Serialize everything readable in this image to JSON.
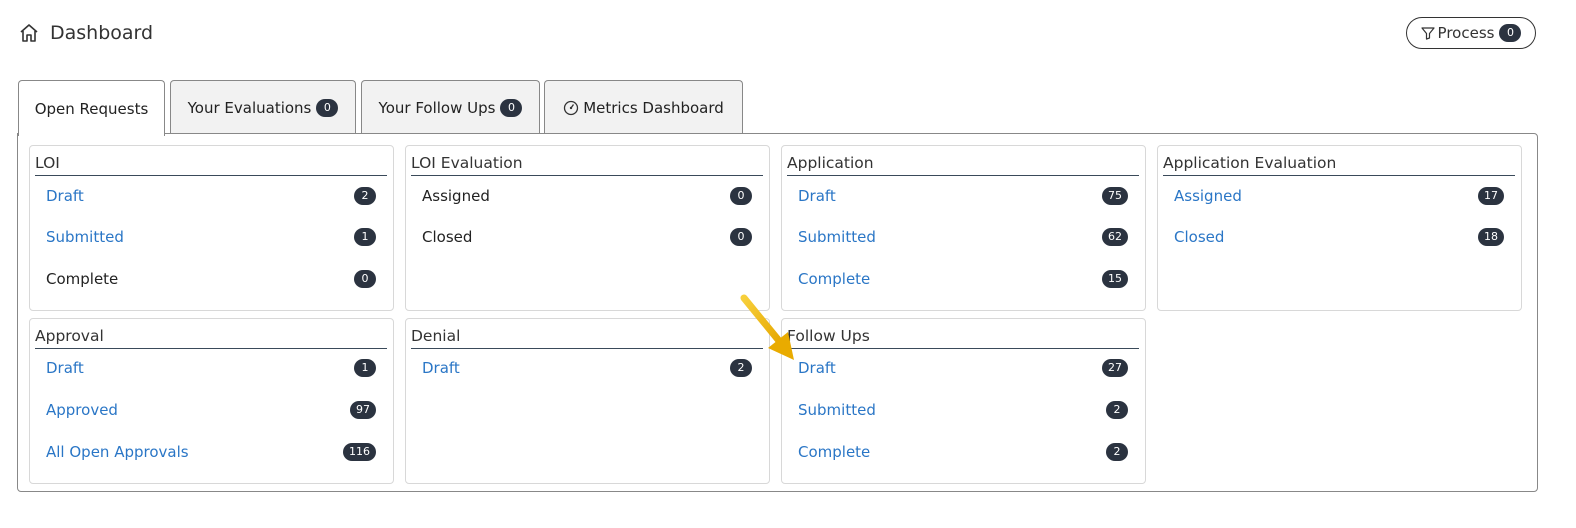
{
  "header": {
    "title": "Dashboard"
  },
  "process": {
    "label": "Process",
    "count": "0"
  },
  "tabs": [
    {
      "label": "Open Requests",
      "count": null
    },
    {
      "label": "Your Evaluations",
      "count": "0"
    },
    {
      "label": "Your Follow Ups",
      "count": "0"
    },
    {
      "label": "Metrics Dashboard",
      "count": null
    }
  ],
  "cards": {
    "loi": {
      "title": "LOI",
      "rows": [
        {
          "label": "Draft",
          "count": "2"
        },
        {
          "label": "Submitted",
          "count": "1"
        },
        {
          "label": "Complete",
          "count": "0"
        }
      ]
    },
    "loi_eval": {
      "title": "LOI Evaluation",
      "rows": [
        {
          "label": "Assigned",
          "count": "0"
        },
        {
          "label": "Closed",
          "count": "0"
        }
      ]
    },
    "application": {
      "title": "Application",
      "rows": [
        {
          "label": "Draft",
          "count": "75"
        },
        {
          "label": "Submitted",
          "count": "62"
        },
        {
          "label": "Complete",
          "count": "15"
        }
      ]
    },
    "app_eval": {
      "title": "Application Evaluation",
      "rows": [
        {
          "label": "Assigned",
          "count": "17"
        },
        {
          "label": "Closed",
          "count": "18"
        }
      ]
    },
    "approval": {
      "title": "Approval",
      "rows": [
        {
          "label": "Draft",
          "count": "1"
        },
        {
          "label": "Approved",
          "count": "97"
        },
        {
          "label": "All Open Approvals",
          "count": "116"
        }
      ]
    },
    "denial": {
      "title": "Denial",
      "rows": [
        {
          "label": "Draft",
          "count": "2"
        }
      ]
    },
    "followups": {
      "title": "Follow Ups",
      "rows": [
        {
          "label": "Draft",
          "count": "27"
        },
        {
          "label": "Submitted",
          "count": "2"
        },
        {
          "label": "Complete",
          "count": "2"
        }
      ]
    }
  },
  "colors": {
    "link": "#2a76c6",
    "badge": "#2b3340",
    "arrow": "#f2b705"
  }
}
